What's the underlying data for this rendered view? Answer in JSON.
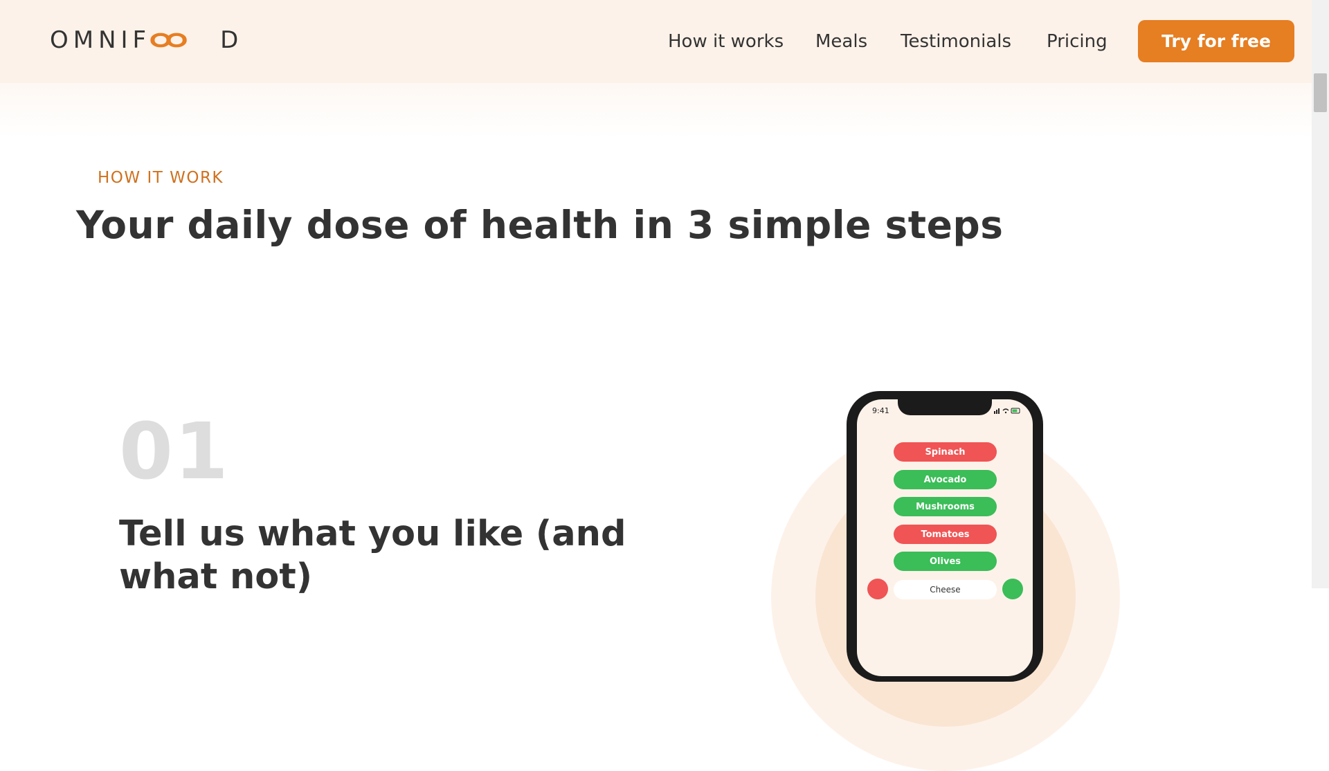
{
  "header": {
    "logo_text_left": "OMNIF",
    "logo_text_right": "D",
    "nav": [
      "How it works",
      "Meals",
      "Testimonials",
      "Pricing"
    ],
    "cta_label": "Try for free"
  },
  "section": {
    "subheading": "HOW IT WORK",
    "heading": "Your daily dose of health in 3 simple steps"
  },
  "step": {
    "number": "01",
    "title": "Tell us what you like (and what not)"
  },
  "phone": {
    "time": "9:41",
    "items": [
      {
        "label": "Spinach",
        "status": "red"
      },
      {
        "label": "Avocado",
        "status": "green"
      },
      {
        "label": "Mushrooms",
        "status": "green"
      },
      {
        "label": "Tomatoes",
        "status": "red"
      },
      {
        "label": "Olives",
        "status": "green"
      }
    ],
    "choose_label": "Cheese"
  },
  "colors": {
    "accent": "#e67e22",
    "subheading": "#cf711f",
    "header_bg": "#fdf2e9",
    "pill_red": "#f05454",
    "pill_green": "#3bbd58"
  }
}
